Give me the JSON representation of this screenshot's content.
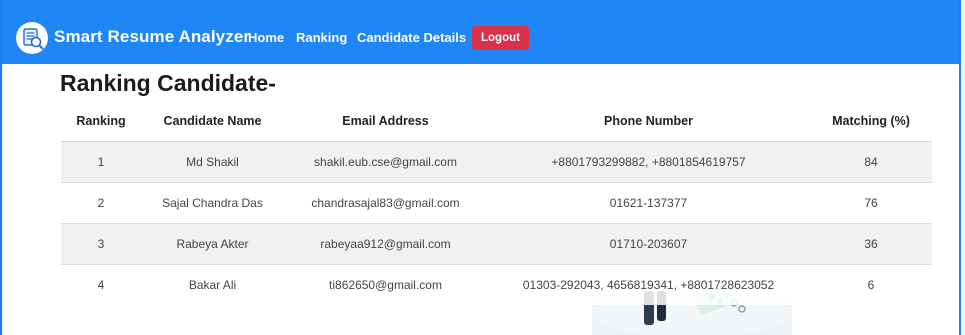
{
  "navbar": {
    "brand": "Smart Resume Analyzer",
    "links": [
      {
        "label": "Home"
      },
      {
        "label": "Ranking"
      },
      {
        "label": "Candidate Details"
      }
    ],
    "logout_label": "Logout"
  },
  "page": {
    "title": "Ranking Candidate-"
  },
  "table": {
    "headers": [
      "Ranking",
      "Candidate Name",
      "Email Address",
      "Phone Number",
      "Matching (%)"
    ],
    "rows": [
      [
        "1",
        "Md Shakil",
        "shakil.eub.cse@gmail.com",
        "+8801793299882, +8801854619757",
        "84"
      ],
      [
        "2",
        "Sajal Chandra Das",
        "chandrasajal83@gmail.com",
        "01621-137377",
        "76"
      ],
      [
        "3",
        "Rabeya Akter",
        "rabeyaa912@gmail.com",
        "01710-203607",
        "36"
      ],
      [
        "4",
        "Bakar Ali",
        "ti862650@gmail.com",
        "01303-292043, 4656819341, +8801728623052",
        "6"
      ]
    ]
  },
  "colors": {
    "navbar": "#1e86f5",
    "logout": "#d9314a",
    "row_stripe": "#f0f0f0"
  },
  "icons": {
    "brand": "resume-search-icon"
  }
}
